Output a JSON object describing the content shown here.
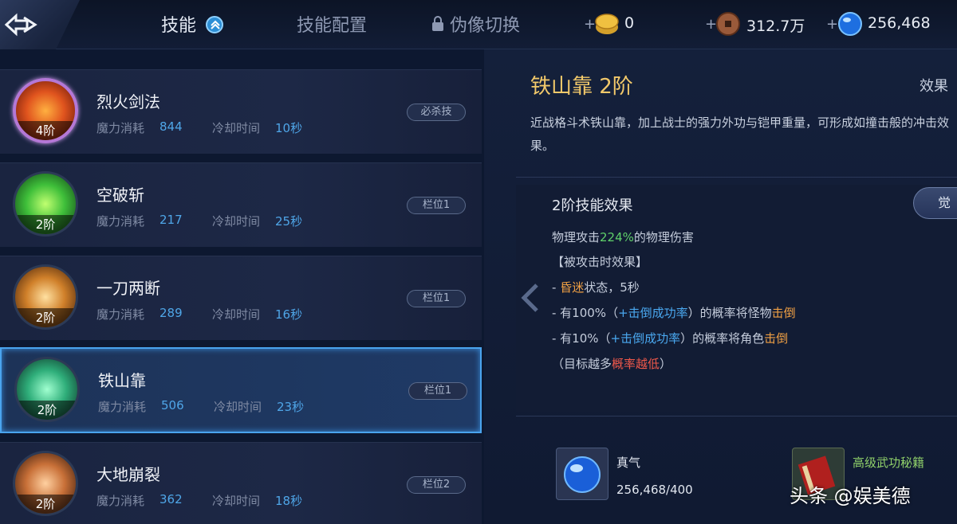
{
  "header": {
    "tabs": [
      {
        "label": "技能"
      },
      {
        "label": "技能配置"
      },
      {
        "label": "伪像切换"
      }
    ],
    "currencies": [
      {
        "icon": "gold-coin-icon",
        "value": "0"
      },
      {
        "icon": "copper-coin-icon",
        "value": "312.7万"
      },
      {
        "icon": "blue-gem-icon",
        "value": "256,468"
      }
    ],
    "plus": "+"
  },
  "skills": [
    {
      "name": "烈火剑法",
      "rank": "4阶",
      "mana_label": "魔力消耗",
      "mana": "844",
      "cd_label": "冷却时间",
      "cd": "10秒",
      "tag": "必杀技",
      "icon": "fire-dragon-icon",
      "color": "#e0541e"
    },
    {
      "name": "空破斩",
      "rank": "2阶",
      "mana_label": "魔力消耗",
      "mana": "217",
      "cd_label": "冷却时间",
      "cd": "25秒",
      "tag": "栏位1",
      "icon": "green-slash-icon",
      "color": "#3fbf3a"
    },
    {
      "name": "一刀两断",
      "rank": "2阶",
      "mana_label": "魔力消耗",
      "mana": "289",
      "cd_label": "冷却时间",
      "cd": "16秒",
      "tag": "栏位1",
      "icon": "orange-slash-icon",
      "color": "#d0802a"
    },
    {
      "name": "铁山靠",
      "rank": "2阶",
      "mana_label": "魔力消耗",
      "mana": "506",
      "cd_label": "冷却时间",
      "cd": "23秒",
      "tag": "栏位1",
      "icon": "green-warrior-icon",
      "color": "#2fae7a"
    },
    {
      "name": "大地崩裂",
      "rank": "2阶",
      "mana_label": "魔力消耗",
      "mana": "362",
      "cd_label": "冷却时间",
      "cd": "18秒",
      "tag": "栏位2",
      "icon": "earth-crack-icon",
      "color": "#c87038"
    }
  ],
  "detail": {
    "title": "铁山靠 2阶",
    "effect_tab": "效果",
    "description": "近战格斗术铁山靠，加上战士的强力外功与铠甲重量，可形成如撞击般的冲击效果。",
    "effect_title": "2阶技能效果",
    "awaken_label": "觉",
    "line1_a": "物理攻击",
    "line1_b": "224%",
    "line1_c": "的物理伤害",
    "line2": "【被攻击时效果】",
    "line3_a": "- ",
    "line3_b": "昏迷",
    "line3_c": "状态，5秒",
    "line4_a": "- 有100%（",
    "line4_b": "+击倒成功率",
    "line4_c": "）的概率将怪物",
    "line4_d": "击倒",
    "line5_a": "- 有10%（",
    "line5_b": "+击倒成功率",
    "line5_c": "）的概率将角色",
    "line5_d": "击倒",
    "line6_a": "（目标越多",
    "line6_b": "概率越低",
    "line6_c": "）",
    "resource_name": "真气",
    "resource_count": "256,468/400",
    "book_name": "高级武功秘籍"
  },
  "watermark": "头条 @娱美德"
}
